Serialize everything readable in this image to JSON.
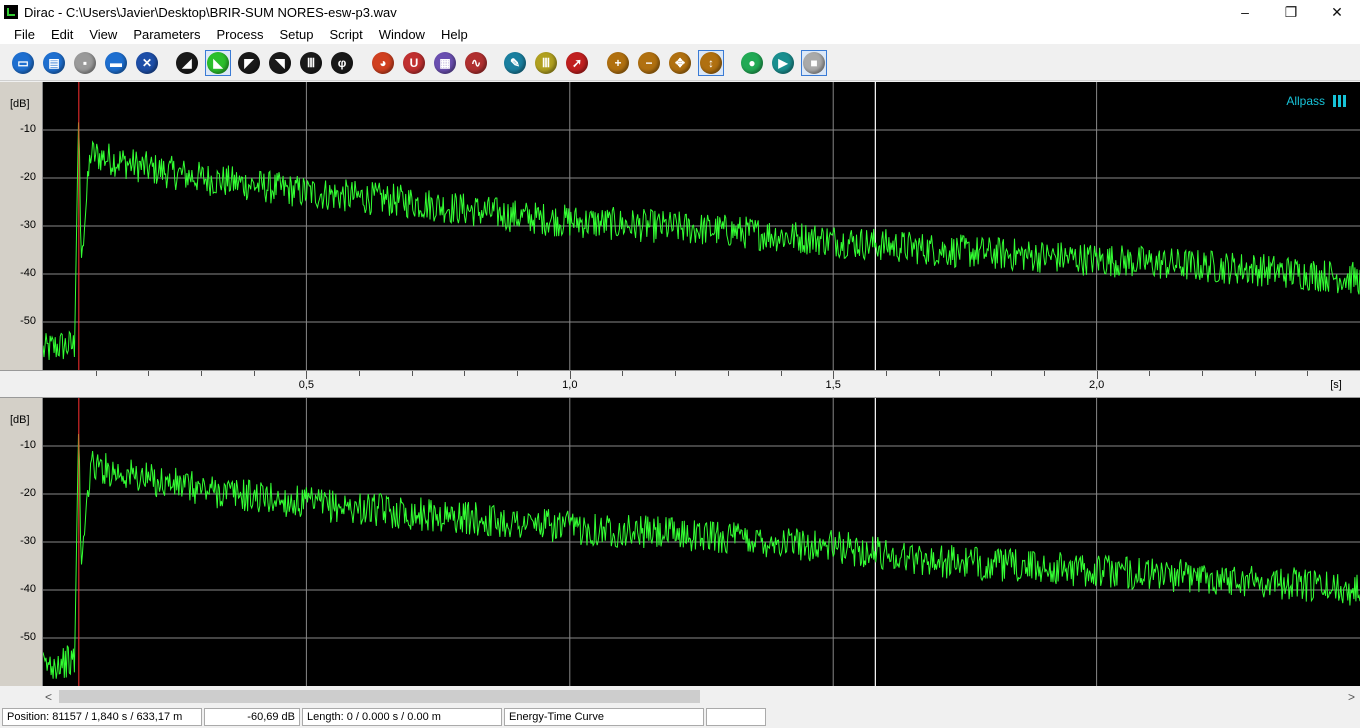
{
  "window": {
    "title": "Dirac - C:\\Users\\Javier\\Desktop\\BRIR-SUM NORES-esw-p3.wav",
    "controls": [
      "–",
      "❐",
      "✕"
    ]
  },
  "menu": [
    "File",
    "Edit",
    "View",
    "Parameters",
    "Process",
    "Setup",
    "Script",
    "Window",
    "Help"
  ],
  "toolbar": [
    {
      "name": "new-file",
      "glyph": "▭",
      "color": "#1e6fd0"
    },
    {
      "name": "open-file",
      "glyph": "▤",
      "color": "#1e6fd0"
    },
    {
      "name": "save-file",
      "glyph": "▪",
      "color": "#9a9a9a"
    },
    {
      "name": "print",
      "glyph": "▬",
      "color": "#1e6fd0"
    },
    {
      "name": "close-file",
      "glyph": "✕",
      "color": "#1e4fa8"
    },
    {
      "name": "impulse-response",
      "glyph": "◢",
      "color": "#1a1a1a"
    },
    {
      "name": "energy-time",
      "glyph": "◣",
      "color": "#2bbf2b"
    },
    {
      "name": "decay-curve",
      "glyph": "◤",
      "color": "#1a1a1a"
    },
    {
      "name": "schroeder",
      "glyph": "◥",
      "color": "#1a1a1a"
    },
    {
      "name": "spectrum-bars",
      "glyph": "Ⅲ",
      "color": "#1a1a1a"
    },
    {
      "name": "phase",
      "glyph": "φ",
      "color": "#1a1a1a"
    },
    {
      "name": "color-map",
      "glyph": "◕",
      "color": "#d04020"
    },
    {
      "name": "magnet",
      "glyph": "U",
      "color": "#c03030"
    },
    {
      "name": "grid-view",
      "glyph": "▦",
      "color": "#6a4fb0"
    },
    {
      "name": "waveform-view",
      "glyph": "∿",
      "color": "#b03030"
    },
    {
      "name": "pen-tool",
      "glyph": "✎",
      "color": "#1a7f9f"
    },
    {
      "name": "bars-tool",
      "glyph": "Ⅲ",
      "color": "#b0a020"
    },
    {
      "name": "arrow-tool",
      "glyph": "➚",
      "color": "#c02020"
    },
    {
      "name": "zoom-in",
      "glyph": "+",
      "color": "#b07010"
    },
    {
      "name": "zoom-out",
      "glyph": "−",
      "color": "#b07010"
    },
    {
      "name": "zoom-fit",
      "glyph": "✥",
      "color": "#b07010"
    },
    {
      "name": "zoom-vertical",
      "glyph": "↕",
      "color": "#b07010"
    },
    {
      "name": "record",
      "glyph": "●",
      "color": "#22aa55"
    },
    {
      "name": "play",
      "glyph": "▶",
      "color": "#1a8f8f"
    },
    {
      "name": "stop",
      "glyph": "■",
      "color": "#aaaaaa"
    }
  ],
  "panels": [
    {
      "unit": "[dB]",
      "legend": "Allpass"
    },
    {
      "unit": "[dB]",
      "legend": ""
    }
  ],
  "y_ticks": [
    "-10",
    "-20",
    "-30",
    "-40",
    "-50"
  ],
  "x_axis": {
    "ticks": [
      "0,5",
      "1,0",
      "1,5",
      "2,0"
    ],
    "unit": "[s]"
  },
  "scroll": {
    "left": "<",
    "right": ">"
  },
  "status": {
    "position": "Position: 81157 / 1,840 s / 633,17 m",
    "level": "-60,69 dB",
    "length": "Length: 0 / 0.000 s / 0.00 m",
    "view": "Energy-Time Curve"
  },
  "colors": {
    "trace": "#33ff33",
    "marker": "#ff3030",
    "grid": "#888888",
    "cursor": "#ffffff",
    "legend": "#17c3d8"
  },
  "chart_data": [
    {
      "type": "line",
      "title": "",
      "xlabel": "[s]",
      "ylabel": "[dB]",
      "xlim": [
        0,
        2.5
      ],
      "ylim": [
        -60,
        0
      ],
      "x_ticks": [
        0.5,
        1.0,
        1.5,
        2.0
      ],
      "y_ticks": [
        -10,
        -20,
        -30,
        -40,
        -50
      ],
      "cursor_x": 1.58,
      "marker_x": 0.068,
      "grid": true,
      "series": [
        {
          "x": [
            0,
            0.03,
            0.06,
            0.068,
            0.072,
            0.09,
            0.2,
            0.3,
            0.5,
            0.7,
            0.9,
            1.0,
            1.3,
            1.5,
            1.7,
            2.0,
            2.3,
            2.5
          ],
          "y": [
            -56,
            -55,
            -55,
            -4,
            -38,
            -15,
            -18,
            -20,
            -23,
            -25,
            -28,
            -29,
            -31,
            -33,
            -35,
            -37,
            -39,
            -41
          ]
        }
      ]
    },
    {
      "type": "line",
      "title": "",
      "xlabel": "[s]",
      "ylabel": "[dB]",
      "xlim": [
        0,
        2.5
      ],
      "ylim": [
        -60,
        0
      ],
      "x_ticks": [
        0.5,
        1.0,
        1.5,
        2.0
      ],
      "y_ticks": [
        -10,
        -20,
        -30,
        -40,
        -50
      ],
      "cursor_x": 1.58,
      "marker_x": 0.068,
      "grid": true,
      "series": [
        {
          "x": [
            0,
            0.03,
            0.06,
            0.068,
            0.072,
            0.09,
            0.2,
            0.3,
            0.5,
            0.7,
            0.9,
            1.0,
            1.3,
            1.5,
            1.7,
            2.0,
            2.3,
            2.5
          ],
          "y": [
            -56,
            -55,
            -55,
            -3,
            -36,
            -14,
            -17,
            -19,
            -22,
            -24,
            -26,
            -27,
            -29,
            -31,
            -34,
            -36,
            -38,
            -40
          ]
        }
      ]
    }
  ]
}
